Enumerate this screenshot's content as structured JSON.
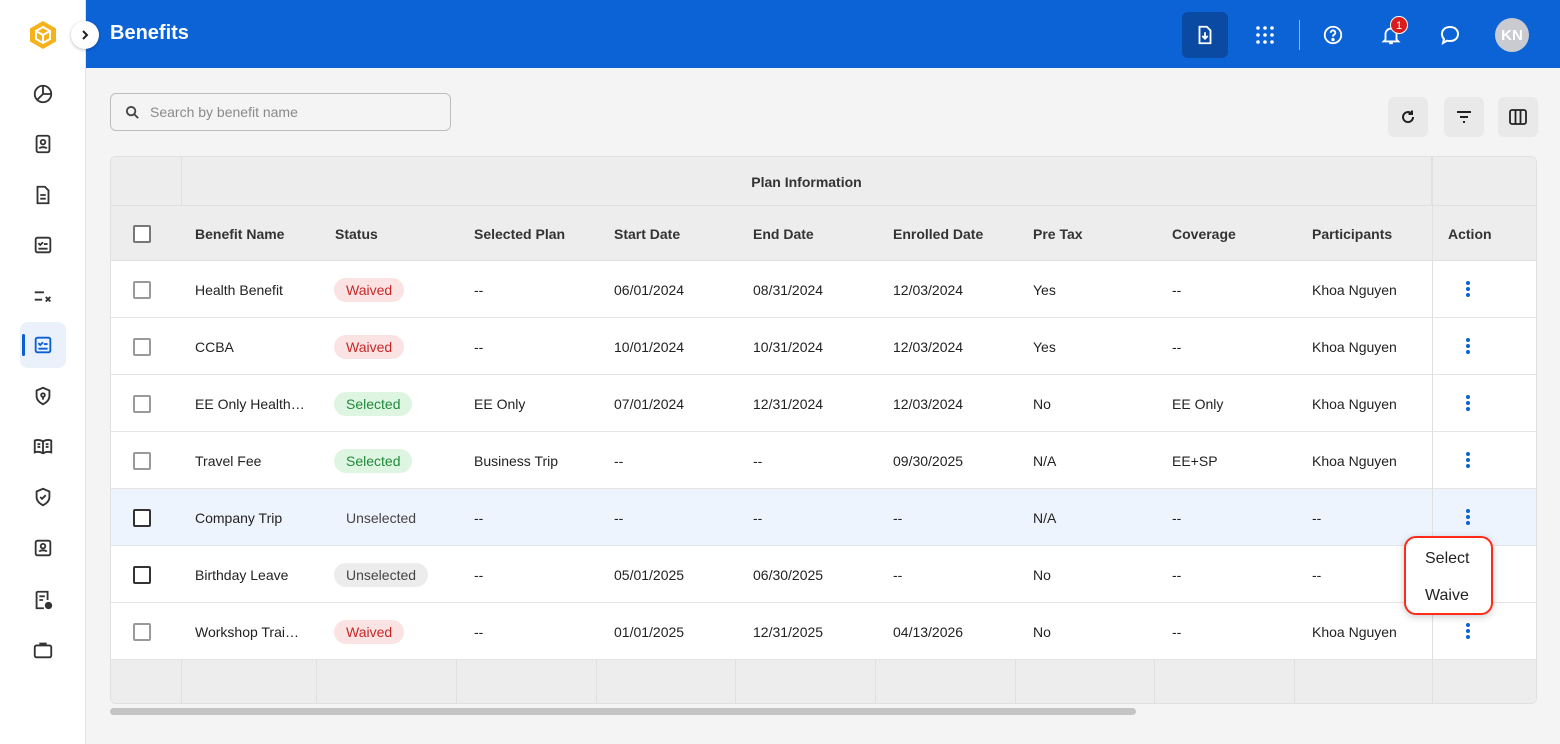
{
  "header": {
    "title": "Benefits",
    "notification_count": "1",
    "avatar_initials": "KN"
  },
  "nav": {
    "items": [
      "dashboard",
      "profile",
      "documents",
      "tasks",
      "checklist",
      "benefits",
      "security",
      "handbook",
      "compliance",
      "directory",
      "requests",
      "jobs"
    ],
    "active": "benefits"
  },
  "search": {
    "placeholder": "Search by benefit name",
    "value": ""
  },
  "table": {
    "group_header": "Plan Information",
    "columns": [
      "Benefit Name",
      "Status",
      "Selected Plan",
      "Start Date",
      "End Date",
      "Enrolled Date",
      "Pre Tax",
      "Coverage",
      "Participants",
      "Action"
    ],
    "rows": [
      {
        "name": "Health Benefit",
        "status": "Waived",
        "plan": "--",
        "start": "06/01/2024",
        "end": "08/31/2024",
        "enrolled": "12/03/2024",
        "pretax": "Yes",
        "coverage": "--",
        "participants": "Khoa Nguyen"
      },
      {
        "name": "CCBA",
        "status": "Waived",
        "plan": "--",
        "start": "10/01/2024",
        "end": "10/31/2024",
        "enrolled": "12/03/2024",
        "pretax": "Yes",
        "coverage": "--",
        "participants": "Khoa Nguyen"
      },
      {
        "name": "EE Only Health…",
        "status": "Selected",
        "plan": "EE Only",
        "start": "07/01/2024",
        "end": "12/31/2024",
        "enrolled": "12/03/2024",
        "pretax": "No",
        "coverage": "EE Only",
        "participants": "Khoa Nguyen"
      },
      {
        "name": "Travel Fee",
        "status": "Selected",
        "plan": "Business Trip",
        "start": "--",
        "end": "--",
        "enrolled": "09/30/2025",
        "pretax": "N/A",
        "coverage": "EE+SP",
        "participants": "Khoa Nguyen"
      },
      {
        "name": "Company Trip",
        "status": "Unselected",
        "plan": "--",
        "start": "--",
        "end": "--",
        "enrolled": "--",
        "pretax": "N/A",
        "coverage": "--",
        "participants": "--"
      },
      {
        "name": "Birthday Leave",
        "status": "Unselected",
        "plan": "--",
        "start": "05/01/2025",
        "end": "06/30/2025",
        "enrolled": "--",
        "pretax": "No",
        "coverage": "--",
        "participants": "--"
      },
      {
        "name": "Workshop Trai…",
        "status": "Waived",
        "plan": "--",
        "start": "01/01/2025",
        "end": "12/31/2025",
        "enrolled": "04/13/2026",
        "pretax": "No",
        "coverage": "--",
        "participants": "Khoa Nguyen"
      }
    ]
  },
  "action_menu": {
    "items": [
      "Select",
      "Waive"
    ]
  },
  "colors": {
    "brand": "#0c63d6",
    "waived": "#c62828",
    "selected": "#1f8a3a",
    "highlight": "#ff2a1a"
  }
}
